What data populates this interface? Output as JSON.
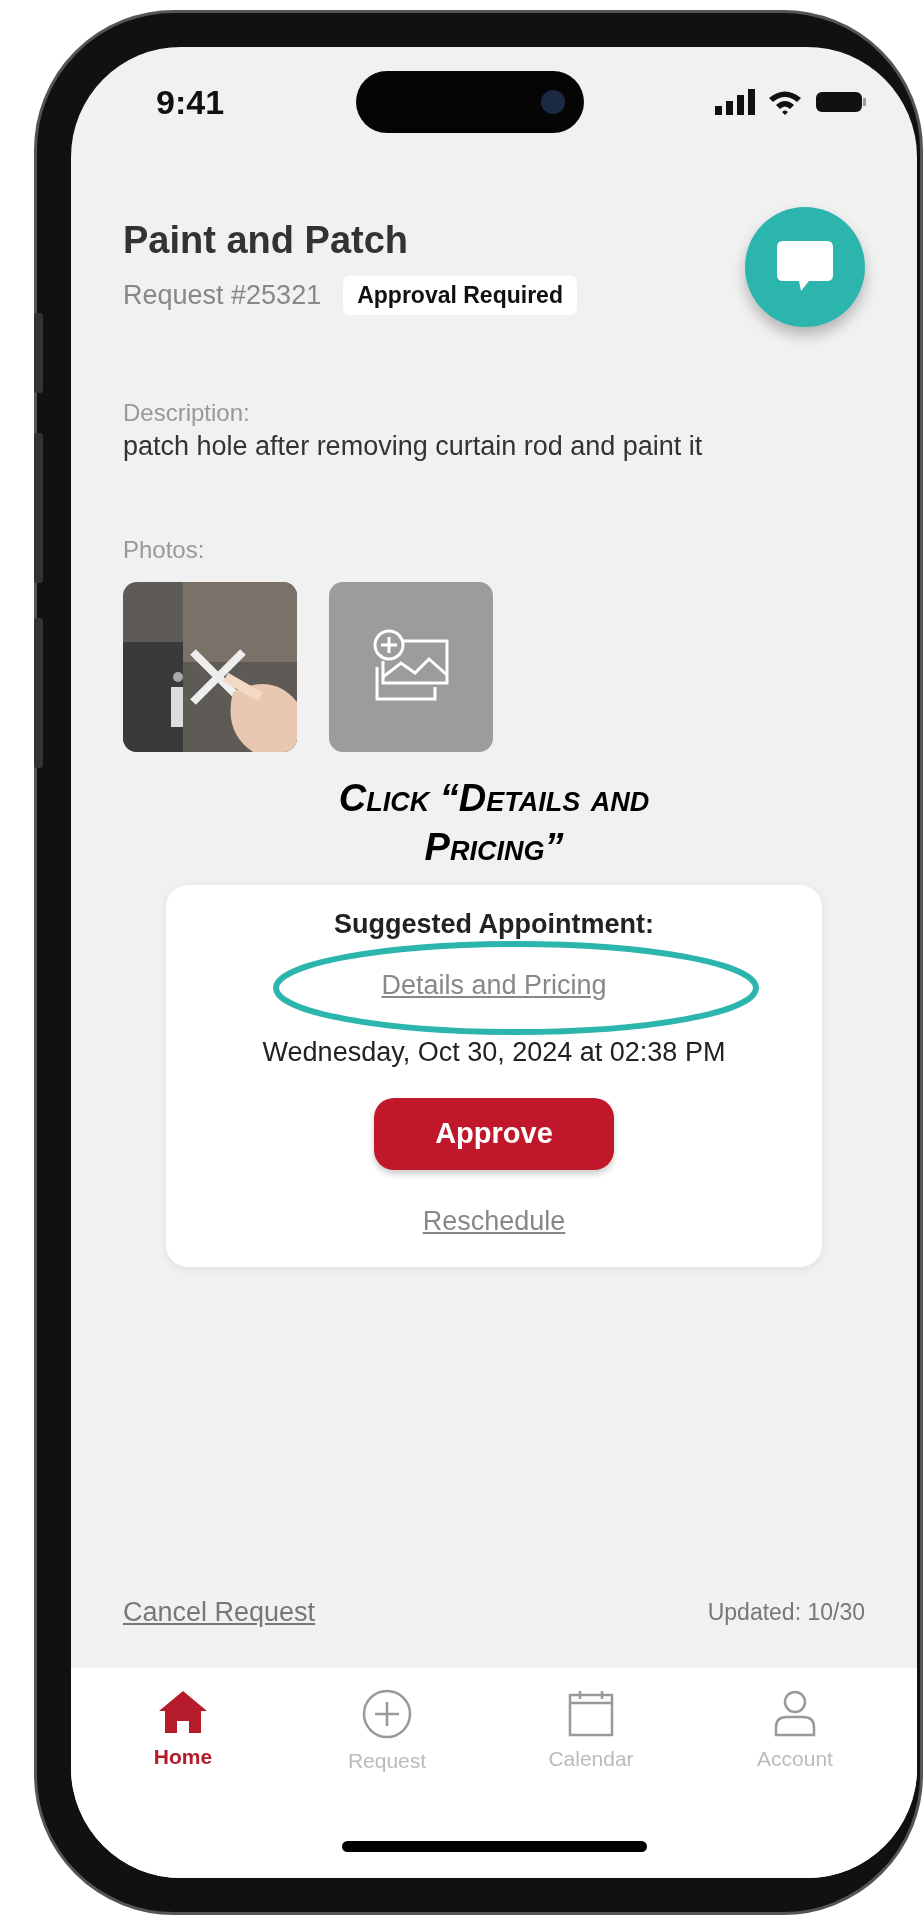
{
  "status_bar": {
    "time": "9:41"
  },
  "header": {
    "title": "Paint and Patch",
    "request_number": "Request #25321",
    "badge": "Approval Required"
  },
  "description": {
    "label": "Description:",
    "text": "patch hole after removing curtain rod and paint it"
  },
  "photos": {
    "label": "Photos:",
    "items": [
      {
        "kind": "picture"
      },
      {
        "kind": "add"
      }
    ]
  },
  "annotation": {
    "text": "Click “Details and Pricing”"
  },
  "appointment": {
    "title": "Suggested Appointment:",
    "details_link": "Details and Pricing",
    "datetime": "Wednesday, Oct 30, 2024 at 02:38 PM",
    "approve": "Approve",
    "reschedule": "Reschedule"
  },
  "footer": {
    "cancel": "Cancel Request",
    "updated": "Updated: 10/30"
  },
  "tabs": [
    {
      "label": "Home",
      "kind": "home",
      "selected": true
    },
    {
      "label": "Request",
      "kind": "request",
      "selected": false
    },
    {
      "label": "Calendar",
      "kind": "calendar",
      "selected": false
    },
    {
      "label": "Account",
      "kind": "account",
      "selected": false
    }
  ]
}
